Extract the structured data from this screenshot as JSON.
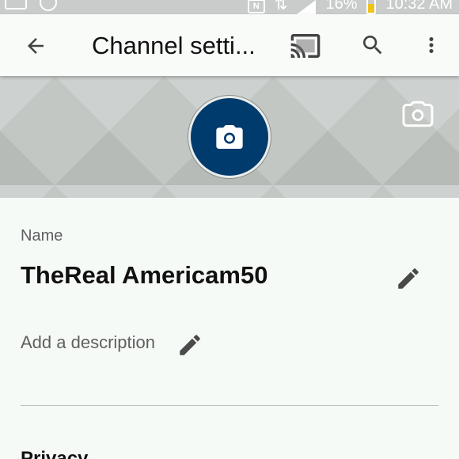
{
  "status_bar": {
    "battery": "16%",
    "time": "10:32 AM",
    "icons": [
      "notification-icon",
      "wifi-icon",
      "nfc-icon",
      "data-transfer-icon",
      "signal-icon",
      "battery-icon"
    ]
  },
  "app_bar": {
    "title": "Channel setti...",
    "back_icon": "arrow-back-icon",
    "cast_icon": "cast-icon",
    "search_icon": "search-icon",
    "more_icon": "more-vert-icon"
  },
  "banner": {
    "avatar_icon": "camera-icon",
    "banner_icon": "camera-icon",
    "avatar_color": "#003b6e"
  },
  "profile": {
    "name_label": "Name",
    "name_value": "TheReal Americam50",
    "description_placeholder": "Add a description",
    "edit_icon": "pencil-icon"
  },
  "sections": {
    "privacy_header": "Privacy"
  }
}
